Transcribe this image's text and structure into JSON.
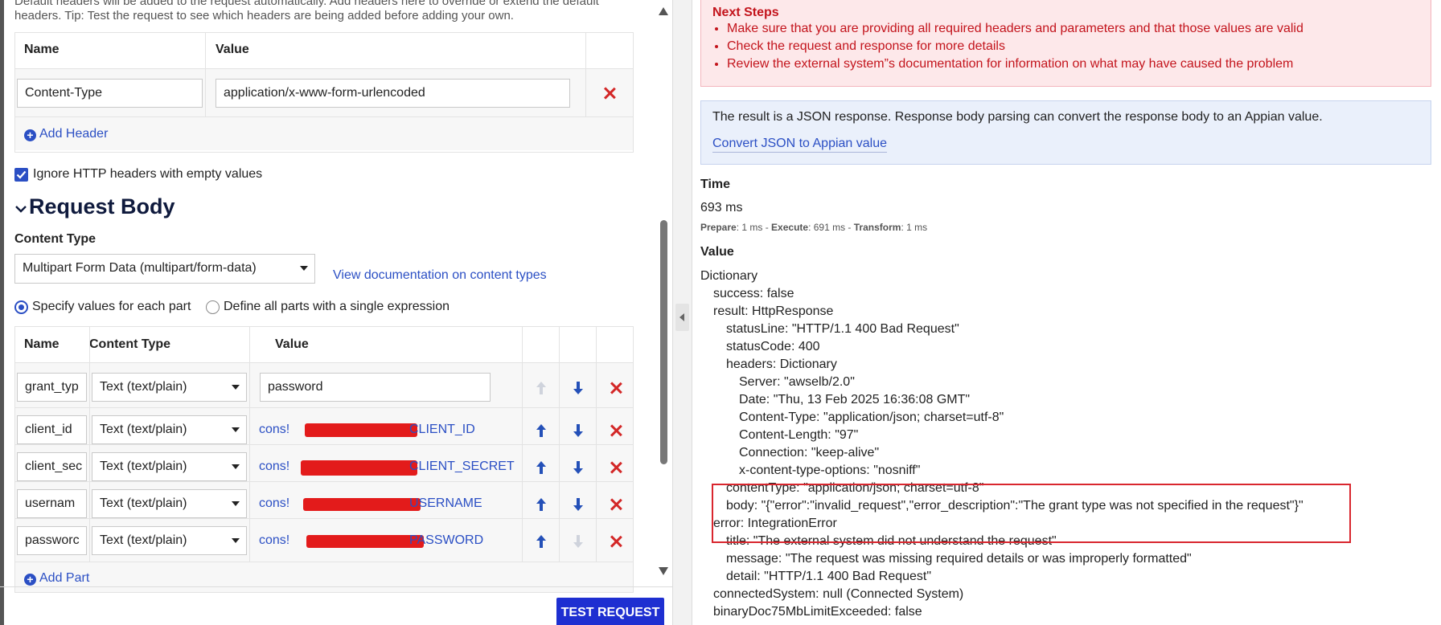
{
  "headers_section": {
    "description_line1": "Default headers will be added to the request automatically. Add headers here to override or extend the default",
    "description_line2": "headers. Tip: Test the request to see which headers are being added before adding your own.",
    "columns": [
      "Name",
      "Value"
    ],
    "rows": [
      {
        "name": "Content-Type",
        "value": "application/x-www-form-urlencoded"
      }
    ],
    "add_header_label": "Add Header",
    "ignore_empty_label": "Ignore HTTP headers with empty values",
    "ignore_empty_checked": true
  },
  "request_body": {
    "title": "Request Body",
    "content_type_label": "Content Type",
    "content_type_value": "Multipart Form Data (multipart/form-data)",
    "docs_link": "View documentation on content types",
    "option_specify": "Specify values for each part",
    "option_single": "Define all parts with a single expression",
    "selected_option": "specify",
    "columns": [
      "Name",
      "Content Type",
      "Value"
    ],
    "parts": [
      {
        "name": "grant_typ",
        "content_type": "Text (text/plain)",
        "value": "password",
        "value_is_constant": false
      },
      {
        "name": "client_id",
        "content_type": "Text (text/plain)",
        "value_prefix": "cons!",
        "value_suffix": "CLIENT_ID",
        "value_is_constant": true
      },
      {
        "name": "client_sec",
        "content_type": "Text (text/plain)",
        "value_prefix": "cons!",
        "value_suffix": "CLIENT_SECRET",
        "value_is_constant": true
      },
      {
        "name": "usernam",
        "content_type": "Text (text/plain)",
        "value_prefix": "cons!",
        "value_suffix": "USERNAME",
        "value_is_constant": true
      },
      {
        "name": "passworc",
        "content_type": "Text (text/plain)",
        "value_prefix": "cons!",
        "value_suffix": "PASSWORD",
        "value_is_constant": true
      }
    ],
    "add_part_label": "Add Part",
    "test_button": "TEST REQUEST"
  },
  "result": {
    "next_steps_title": "Next Steps",
    "next_steps": [
      "Make sure that you are providing all required headers and parameters and that those values are valid",
      "Check the request and response for more details",
      "Review the external system”s documentation for information on what may have caused the problem"
    ],
    "info_text": "The result is a JSON response. Response body parsing can convert the response body to an Appian value.",
    "info_link": "Convert JSON to Appian value",
    "time_label": "Time",
    "time_value": "693 ms",
    "timing": {
      "prepare_label": "Prepare",
      "prepare_value": ": 1 ms - ",
      "execute_label": "Execute",
      "execute_value": ": 691 ms - ",
      "transform_label": "Transform",
      "transform_value": ": 1 ms"
    },
    "value_label": "Value",
    "tree": [
      {
        "indent": 0,
        "text": "Dictionary"
      },
      {
        "indent": 1,
        "text": "success: false"
      },
      {
        "indent": 1,
        "text": "result: HttpResponse"
      },
      {
        "indent": 2,
        "text": "statusLine: \"HTTP/1.1 400 Bad Request\""
      },
      {
        "indent": 2,
        "text": "statusCode: 400"
      },
      {
        "indent": 2,
        "text": "headers: Dictionary"
      },
      {
        "indent": 3,
        "text": "Server: \"awselb/2.0\""
      },
      {
        "indent": 3,
        "text": "Date: \"Thu, 13 Feb 2025 16:36:08 GMT\""
      },
      {
        "indent": 3,
        "text": "Content-Type: \"application/json; charset=utf-8\""
      },
      {
        "indent": 3,
        "text": "Content-Length: \"97\""
      },
      {
        "indent": 3,
        "text": "Connection: \"keep-alive\""
      },
      {
        "indent": 3,
        "text": "x-content-type-options: \"nosniff\""
      },
      {
        "indent": 2,
        "text": "contentType: \"application/json; charset=utf-8\""
      },
      {
        "indent": 2,
        "text": "body: \"{\"error\":\"invalid_request\",\"error_description\":\"The grant type was not specified in the request\"}\""
      },
      {
        "indent": 1,
        "text": "error: IntegrationError"
      },
      {
        "indent": 2,
        "text": "title: \"The external system did not understand the request\""
      },
      {
        "indent": 2,
        "text": "message: \"The request was missing required details or was improperly formatted\""
      },
      {
        "indent": 2,
        "text": "detail: \"HTTP/1.1 400 Bad Request\""
      },
      {
        "indent": 1,
        "text": "connectedSystem: null (Connected System)"
      },
      {
        "indent": 1,
        "text": "binaryDoc75MbLimitExceeded: false"
      }
    ]
  },
  "colors": {
    "accent": "#2b4fc4",
    "button": "#1e2fd1",
    "error_text": "#c3141c",
    "error_bg": "#fde8ea",
    "info_bg": "#eaf0fb",
    "delete": "#d32727",
    "redaction": "#e31b1b",
    "highlight": "#d9262e"
  }
}
